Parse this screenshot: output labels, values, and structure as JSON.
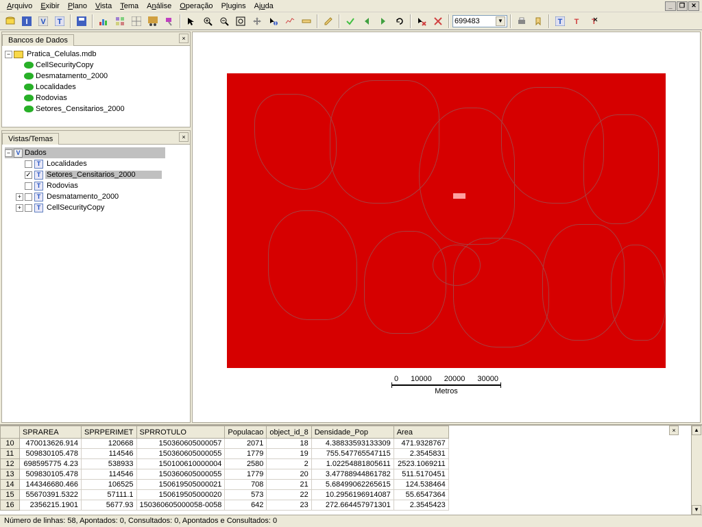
{
  "menu": [
    "Arquivo",
    "Exibir",
    "Plano",
    "Vista",
    "Tema",
    "Análise",
    "Operação",
    "Plugins",
    "Ajuda"
  ],
  "scale_value": "699483",
  "db_panel": {
    "title": "Bancos de Dados",
    "root": "Pratica_Celulas.mdb",
    "layers": [
      "CellSecurityCopy",
      "Desmatamento_2000",
      "Localidades",
      "Rodovias",
      "Setores_Censitarios_2000"
    ]
  },
  "views_panel": {
    "title": "Vistas/Temas",
    "root": "Dados",
    "themes": [
      {
        "name": "Localidades",
        "checked": false,
        "sel": false,
        "expandable": false
      },
      {
        "name": "Setores_Censitarios_2000",
        "checked": true,
        "sel": true,
        "expandable": false
      },
      {
        "name": "Rodovias",
        "checked": false,
        "sel": false,
        "expandable": false
      },
      {
        "name": "Desmatamento_2000",
        "checked": false,
        "sel": false,
        "expandable": true
      },
      {
        "name": "CellSecurityCopy",
        "checked": false,
        "sel": false,
        "expandable": true
      }
    ]
  },
  "scalebar": {
    "ticks": [
      "0",
      "10000",
      "20000",
      "30000"
    ],
    "unit": "Metros"
  },
  "table": {
    "columns": [
      "",
      "SPRAREA",
      "SPRPERIMET",
      "SPRROTULO",
      "Populacao",
      "object_id_8",
      "Densidade_Pop",
      "Area"
    ],
    "rows": [
      [
        "10",
        "470013626.914",
        "120668",
        "150360605000057",
        "2071",
        "18",
        "4.38833593133309",
        "471.9328767"
      ],
      [
        "11",
        "509830105.478",
        "114546",
        "150360605000055",
        "1779",
        "19",
        "755.547765547115",
        "2.3545831"
      ],
      [
        "12",
        "698595775 4.23",
        "538933",
        "150100610000004",
        "2580",
        "2",
        "1.02254881805611",
        "2523.1069211"
      ],
      [
        "13",
        "509830105.478",
        "114546",
        "150360605000055",
        "1779",
        "20",
        "3.47788944861782",
        "511.5170451"
      ],
      [
        "14",
        "144346680.466",
        "106525",
        "150619505000021",
        "708",
        "21",
        "5.68499062265615",
        "124.538464"
      ],
      [
        "15",
        "55670391.5322",
        "57111.1",
        "150619505000020",
        "573",
        "22",
        "10.2956196914087",
        "55.6547364"
      ],
      [
        "16",
        "2356215.1901",
        "5677.93",
        "150360605000058-0058",
        "642",
        "23",
        "272.664457971301",
        "2.3545423"
      ]
    ]
  },
  "status": "Número de linhas: 58, Apontados: 0, Consultados: 0, Apontados e Consultados: 0"
}
